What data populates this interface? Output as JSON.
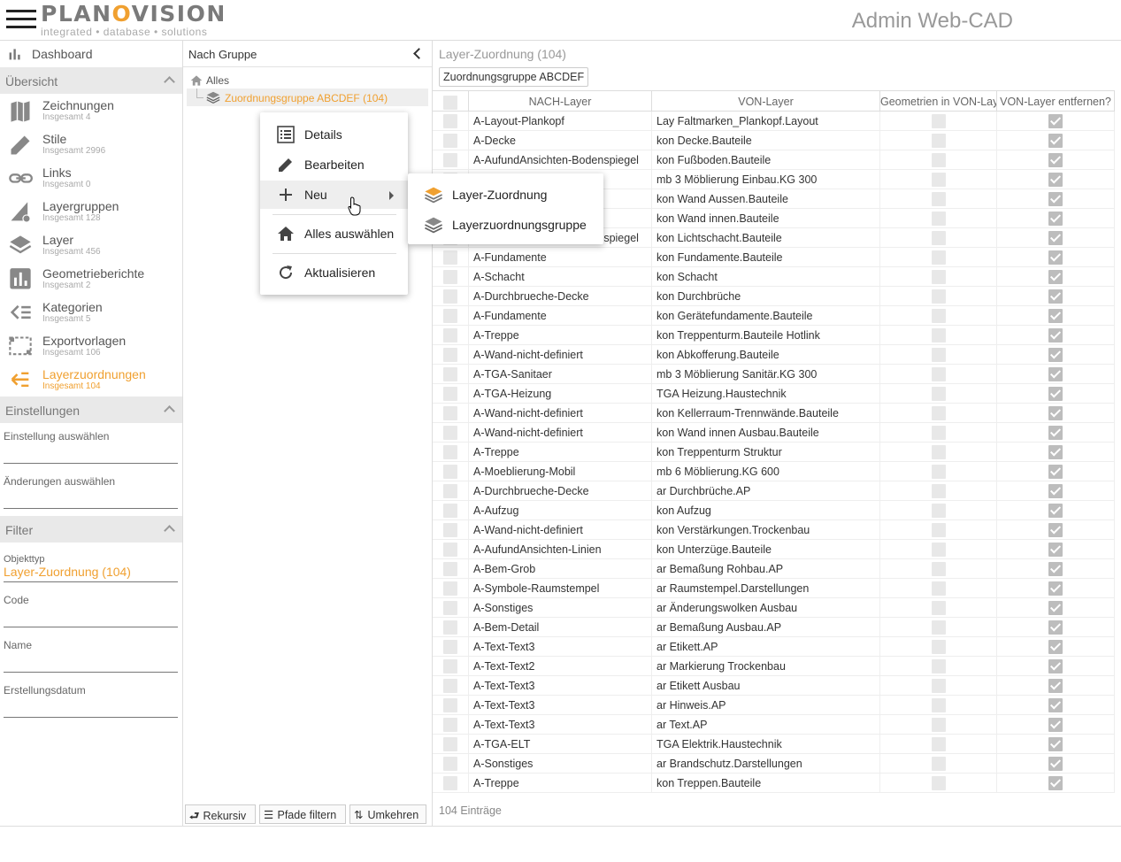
{
  "header": {
    "logo_pre": "PLAN",
    "logo_o": "O",
    "logo_post": "VISION",
    "logo_tagline": "integrated • database • solutions",
    "app_title": "Admin Web-CAD"
  },
  "sidebar": {
    "dashboard_label": "Dashboard",
    "overview_header": "Übersicht",
    "items": [
      {
        "label": "Zeichnungen",
        "sub": "Insgesamt 4",
        "icon": "map-icon"
      },
      {
        "label": "Stile",
        "sub": "Insgesamt 2996",
        "icon": "pencil-icon"
      },
      {
        "label": "Links",
        "sub": "Insgesamt 0",
        "icon": "link-icon"
      },
      {
        "label": "Layergruppen",
        "sub": "Insgesamt 128",
        "icon": "layergroup-icon"
      },
      {
        "label": "Layer",
        "sub": "Insgesamt 456",
        "icon": "layers-icon"
      },
      {
        "label": "Geometrieberichte",
        "sub": "Insgesamt 2",
        "icon": "bar-chart-icon"
      },
      {
        "label": "Kategorien",
        "sub": "Insgesamt 5",
        "icon": "category-icon"
      },
      {
        "label": "Exportvorlagen",
        "sub": "Insgesamt 106",
        "icon": "export-template-icon"
      },
      {
        "label": "Layerzuordnungen",
        "sub": "Insgesamt 104",
        "icon": "mapping-icon"
      }
    ],
    "settings_header": "Einstellungen",
    "settings_select_label": "Einstellung auswählen",
    "changes_select_label": "Änderungen auswählen",
    "filter_header": "Filter",
    "filter_objtype_label": "Objekttyp",
    "filter_objtype_value": "Layer-Zuordnung (104)",
    "filter_code_label": "Code",
    "filter_name_label": "Name",
    "filter_date_label": "Erstellungsdatum"
  },
  "tree": {
    "header": "Nach Gruppe",
    "root": "Alles",
    "group": "Zuordnungsgruppe ABCDEF (104)",
    "btn_recursive": "Rekursiv",
    "btn_filter_paths": "Pfade filtern",
    "btn_reverse": "Umkehren"
  },
  "grid": {
    "title": "Layer-Zuordnung (104)",
    "group_chip": "Zuordnungsgruppe ABCDEF",
    "columns": [
      "NACH-Layer",
      "VON-Layer",
      "Geometrien in VON-Layer",
      "VON-Layer entfernen?"
    ],
    "footer": "104 Einträge",
    "rows": [
      [
        "A-Layout-Plankopf",
        "Lay Faltmarken_Plankopf.Layout"
      ],
      [
        "A-Decke",
        "kon Decke.Bauteile"
      ],
      [
        "A-AufundAnsichten-Bodenspiegel",
        "kon Fußboden.Bauteile"
      ],
      [
        "",
        "mb 3 Möblierung Einbau.KG 300"
      ],
      [
        "",
        "kon Wand Aussen.Bauteile"
      ],
      [
        "",
        "kon Wand innen.Bauteile"
      ],
      [
        "A-AufundAnsichten-Bodenspiegel",
        "kon Lichtschacht.Bauteile"
      ],
      [
        "A-Fundamente",
        "kon Fundamente.Bauteile"
      ],
      [
        "A-Schacht",
        "kon Schacht"
      ],
      [
        "A-Durchbrueche-Decke",
        "kon Durchbrüche"
      ],
      [
        "A-Fundamente",
        "kon Gerätefundamente.Bauteile"
      ],
      [
        "A-Treppe",
        "kon Treppenturm.Bauteile Hotlink"
      ],
      [
        "A-Wand-nicht-definiert",
        "kon Abkofferung.Bauteile"
      ],
      [
        "A-TGA-Sanitaer",
        "mb 3 Möblierung Sanitär.KG 300"
      ],
      [
        "A-TGA-Heizung",
        "TGA Heizung.Haustechnik"
      ],
      [
        "A-Wand-nicht-definiert",
        "kon Kellerraum-Trennwände.Bauteile"
      ],
      [
        "A-Wand-nicht-definiert",
        "kon Wand innen Ausbau.Bauteile"
      ],
      [
        "A-Treppe",
        "kon Treppenturm Struktur"
      ],
      [
        "A-Moeblierung-Mobil",
        "mb 6 Möblierung.KG 600"
      ],
      [
        "A-Durchbrueche-Decke",
        "ar Durchbrüche.AP"
      ],
      [
        "A-Aufzug",
        "kon Aufzug"
      ],
      [
        "A-Wand-nicht-definiert",
        "kon Verstärkungen.Trockenbau"
      ],
      [
        "A-AufundAnsichten-Linien",
        "kon Unterzüge.Bauteile"
      ],
      [
        "A-Bem-Grob",
        "ar Bemaßung Rohbau.AP"
      ],
      [
        "A-Symbole-Raumstempel",
        "ar Raumstempel.Darstellungen"
      ],
      [
        "A-Sonstiges",
        "ar Änderungswolken Ausbau"
      ],
      [
        "A-Bem-Detail",
        "ar Bemaßung Ausbau.AP"
      ],
      [
        "A-Text-Text3",
        "ar Etikett.AP"
      ],
      [
        "A-Text-Text2",
        "ar Markierung Trockenbau"
      ],
      [
        "A-Text-Text3",
        "ar Etikett Ausbau"
      ],
      [
        "A-Text-Text3",
        "ar Hinweis.AP"
      ],
      [
        "A-Text-Text3",
        "ar Text.AP"
      ],
      [
        "A-TGA-ELT",
        "TGA Elektrik.Haustechnik"
      ],
      [
        "A-Sonstiges",
        "ar Brandschutz.Darstellungen"
      ],
      [
        "A-Treppe",
        "kon Treppen.Bauteile"
      ]
    ]
  },
  "context_menu": {
    "details": "Details",
    "edit": "Bearbeiten",
    "new": "Neu",
    "select_all": "Alles auswählen",
    "refresh": "Aktualisieren",
    "submenu": {
      "layer_mapping": "Layer-Zuordnung",
      "layer_mapping_group": "Layerzuordnungsgruppe"
    }
  },
  "colors": {
    "accent": "#f0a030",
    "header_bg": "#e9e9e9"
  }
}
